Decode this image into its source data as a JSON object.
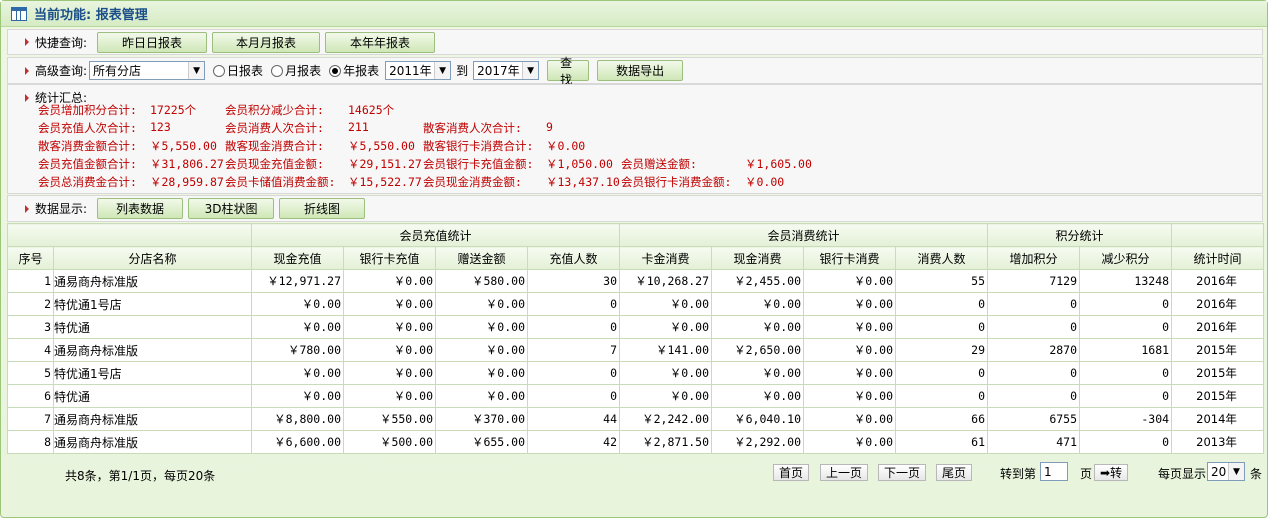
{
  "title": "当前功能: 报表管理",
  "quick": {
    "label": "快捷查询:",
    "buttons": [
      "昨日日报表",
      "本月月报表",
      "本年年报表"
    ]
  },
  "advanced": {
    "label": "高级查询:",
    "store": "所有分店",
    "radio_day": "日报表",
    "radio_month": "月报表",
    "radio_year": "年报表",
    "year_from": "2011年",
    "to": "到",
    "year_to": "2017年",
    "search": "查找",
    "export": "数据导出"
  },
  "summary": {
    "label": "统计汇总:",
    "lines": [
      [
        [
          "会员增加积分合计:",
          "17225个"
        ],
        [
          "会员积分减少合计:",
          "14625个"
        ]
      ],
      [
        [
          "会员充值人次合计:",
          "123"
        ],
        [
          "会员消费人次合计:",
          "211"
        ],
        [
          "散客消费人次合计:",
          "9"
        ]
      ],
      [
        [
          "散客消费金额合计:",
          "￥5,550.00"
        ],
        [
          "散客现金消费合计:",
          "￥5,550.00"
        ],
        [
          "散客银行卡消费合计:",
          "￥0.00"
        ]
      ],
      [
        [
          "会员充值金额合计:",
          "￥31,806.27"
        ],
        [
          "会员现金充值金额:",
          "￥29,151.27"
        ],
        [
          "会员银行卡充值金额:",
          "￥1,050.00"
        ],
        [
          "会员赠送金额:",
          "￥1,605.00"
        ]
      ],
      [
        [
          "会员总消费金合计:",
          "￥28,959.87"
        ],
        [
          "会员卡储值消费金额:",
          "￥15,522.77"
        ],
        [
          "会员现金消费金额:",
          "￥13,437.10"
        ],
        [
          "会员银行卡消费金额:",
          "￥0.00"
        ]
      ]
    ]
  },
  "display": {
    "label": "数据显示:",
    "buttons": [
      "列表数据",
      "3D柱状图",
      "折线图"
    ]
  },
  "table": {
    "groups": [
      "会员充值统计",
      "会员消费统计",
      "积分统计"
    ],
    "columns": [
      "序号",
      "分店名称",
      "现金充值",
      "银行卡充值",
      "赠送金额",
      "充值人数",
      "卡金消费",
      "现金消费",
      "银行卡消费",
      "消费人数",
      "增加积分",
      "减少积分",
      "统计时间"
    ],
    "rows": [
      [
        "1",
        "通易商舟标准版",
        "￥12,971.27",
        "￥0.00",
        "￥580.00",
        "30",
        "￥10,268.27",
        "￥2,455.00",
        "￥0.00",
        "55",
        "7129",
        "13248",
        "2016年"
      ],
      [
        "2",
        "特优通1号店",
        "￥0.00",
        "￥0.00",
        "￥0.00",
        "0",
        "￥0.00",
        "￥0.00",
        "￥0.00",
        "0",
        "0",
        "0",
        "2016年"
      ],
      [
        "3",
        "特优通",
        "￥0.00",
        "￥0.00",
        "￥0.00",
        "0",
        "￥0.00",
        "￥0.00",
        "￥0.00",
        "0",
        "0",
        "0",
        "2016年"
      ],
      [
        "4",
        "通易商舟标准版",
        "￥780.00",
        "￥0.00",
        "￥0.00",
        "7",
        "￥141.00",
        "￥2,650.00",
        "￥0.00",
        "29",
        "2870",
        "1681",
        "2015年"
      ],
      [
        "5",
        "特优通1号店",
        "￥0.00",
        "￥0.00",
        "￥0.00",
        "0",
        "￥0.00",
        "￥0.00",
        "￥0.00",
        "0",
        "0",
        "0",
        "2015年"
      ],
      [
        "6",
        "特优通",
        "￥0.00",
        "￥0.00",
        "￥0.00",
        "0",
        "￥0.00",
        "￥0.00",
        "￥0.00",
        "0",
        "0",
        "0",
        "2015年"
      ],
      [
        "7",
        "通易商舟标准版",
        "￥8,800.00",
        "￥550.00",
        "￥370.00",
        "44",
        "￥2,242.00",
        "￥6,040.10",
        "￥0.00",
        "66",
        "6755",
        "-304",
        "2014年"
      ],
      [
        "8",
        "通易商舟标准版",
        "￥6,600.00",
        "￥500.00",
        "￥655.00",
        "42",
        "￥2,871.50",
        "￥2,292.00",
        "￥0.00",
        "61",
        "471",
        "0",
        "2013年"
      ]
    ]
  },
  "footer": {
    "count": "共8条，第1/1页，每页20条",
    "first": "首页",
    "prev": "上一页",
    "next": "下一页",
    "last": "尾页",
    "goto_label": "转到第",
    "goto_value": "1",
    "page_unit": "页",
    "go": "➡转",
    "per_page_label": "每页显示",
    "per_page": "20",
    "per_page_unit": "条"
  }
}
